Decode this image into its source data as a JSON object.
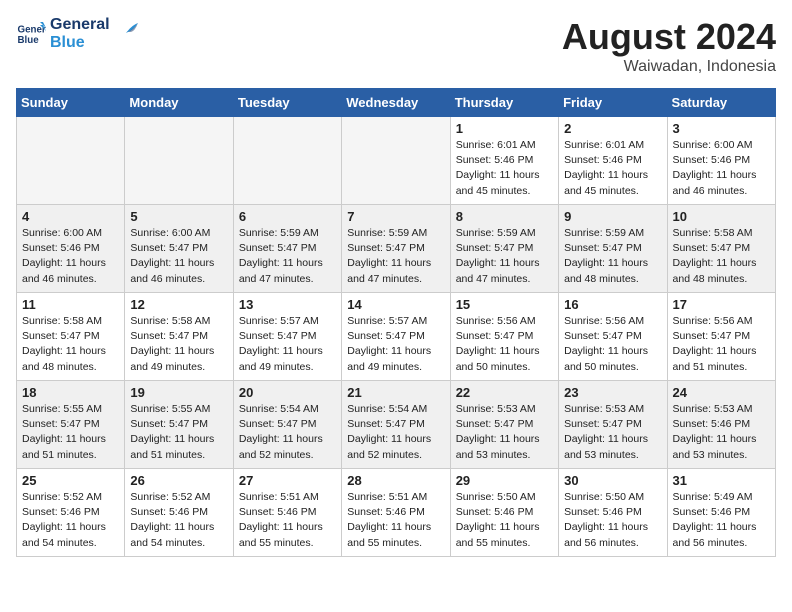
{
  "header": {
    "logo_line1": "General",
    "logo_line2": "Blue",
    "month_year": "August 2024",
    "location": "Waiwadan, Indonesia"
  },
  "weekdays": [
    "Sunday",
    "Monday",
    "Tuesday",
    "Wednesday",
    "Thursday",
    "Friday",
    "Saturday"
  ],
  "weeks": [
    [
      {
        "num": "",
        "info": "",
        "empty": true
      },
      {
        "num": "",
        "info": "",
        "empty": true
      },
      {
        "num": "",
        "info": "",
        "empty": true
      },
      {
        "num": "",
        "info": "",
        "empty": true
      },
      {
        "num": "1",
        "info": "Sunrise: 6:01 AM\nSunset: 5:46 PM\nDaylight: 11 hours\nand 45 minutes."
      },
      {
        "num": "2",
        "info": "Sunrise: 6:01 AM\nSunset: 5:46 PM\nDaylight: 11 hours\nand 45 minutes."
      },
      {
        "num": "3",
        "info": "Sunrise: 6:00 AM\nSunset: 5:46 PM\nDaylight: 11 hours\nand 46 minutes."
      }
    ],
    [
      {
        "num": "4",
        "info": "Sunrise: 6:00 AM\nSunset: 5:46 PM\nDaylight: 11 hours\nand 46 minutes."
      },
      {
        "num": "5",
        "info": "Sunrise: 6:00 AM\nSunset: 5:47 PM\nDaylight: 11 hours\nand 46 minutes."
      },
      {
        "num": "6",
        "info": "Sunrise: 5:59 AM\nSunset: 5:47 PM\nDaylight: 11 hours\nand 47 minutes."
      },
      {
        "num": "7",
        "info": "Sunrise: 5:59 AM\nSunset: 5:47 PM\nDaylight: 11 hours\nand 47 minutes."
      },
      {
        "num": "8",
        "info": "Sunrise: 5:59 AM\nSunset: 5:47 PM\nDaylight: 11 hours\nand 47 minutes."
      },
      {
        "num": "9",
        "info": "Sunrise: 5:59 AM\nSunset: 5:47 PM\nDaylight: 11 hours\nand 48 minutes."
      },
      {
        "num": "10",
        "info": "Sunrise: 5:58 AM\nSunset: 5:47 PM\nDaylight: 11 hours\nand 48 minutes."
      }
    ],
    [
      {
        "num": "11",
        "info": "Sunrise: 5:58 AM\nSunset: 5:47 PM\nDaylight: 11 hours\nand 48 minutes."
      },
      {
        "num": "12",
        "info": "Sunrise: 5:58 AM\nSunset: 5:47 PM\nDaylight: 11 hours\nand 49 minutes."
      },
      {
        "num": "13",
        "info": "Sunrise: 5:57 AM\nSunset: 5:47 PM\nDaylight: 11 hours\nand 49 minutes."
      },
      {
        "num": "14",
        "info": "Sunrise: 5:57 AM\nSunset: 5:47 PM\nDaylight: 11 hours\nand 49 minutes."
      },
      {
        "num": "15",
        "info": "Sunrise: 5:56 AM\nSunset: 5:47 PM\nDaylight: 11 hours\nand 50 minutes."
      },
      {
        "num": "16",
        "info": "Sunrise: 5:56 AM\nSunset: 5:47 PM\nDaylight: 11 hours\nand 50 minutes."
      },
      {
        "num": "17",
        "info": "Sunrise: 5:56 AM\nSunset: 5:47 PM\nDaylight: 11 hours\nand 51 minutes."
      }
    ],
    [
      {
        "num": "18",
        "info": "Sunrise: 5:55 AM\nSunset: 5:47 PM\nDaylight: 11 hours\nand 51 minutes."
      },
      {
        "num": "19",
        "info": "Sunrise: 5:55 AM\nSunset: 5:47 PM\nDaylight: 11 hours\nand 51 minutes."
      },
      {
        "num": "20",
        "info": "Sunrise: 5:54 AM\nSunset: 5:47 PM\nDaylight: 11 hours\nand 52 minutes."
      },
      {
        "num": "21",
        "info": "Sunrise: 5:54 AM\nSunset: 5:47 PM\nDaylight: 11 hours\nand 52 minutes."
      },
      {
        "num": "22",
        "info": "Sunrise: 5:53 AM\nSunset: 5:47 PM\nDaylight: 11 hours\nand 53 minutes."
      },
      {
        "num": "23",
        "info": "Sunrise: 5:53 AM\nSunset: 5:47 PM\nDaylight: 11 hours\nand 53 minutes."
      },
      {
        "num": "24",
        "info": "Sunrise: 5:53 AM\nSunset: 5:46 PM\nDaylight: 11 hours\nand 53 minutes."
      }
    ],
    [
      {
        "num": "25",
        "info": "Sunrise: 5:52 AM\nSunset: 5:46 PM\nDaylight: 11 hours\nand 54 minutes."
      },
      {
        "num": "26",
        "info": "Sunrise: 5:52 AM\nSunset: 5:46 PM\nDaylight: 11 hours\nand 54 minutes."
      },
      {
        "num": "27",
        "info": "Sunrise: 5:51 AM\nSunset: 5:46 PM\nDaylight: 11 hours\nand 55 minutes."
      },
      {
        "num": "28",
        "info": "Sunrise: 5:51 AM\nSunset: 5:46 PM\nDaylight: 11 hours\nand 55 minutes."
      },
      {
        "num": "29",
        "info": "Sunrise: 5:50 AM\nSunset: 5:46 PM\nDaylight: 11 hours\nand 55 minutes."
      },
      {
        "num": "30",
        "info": "Sunrise: 5:50 AM\nSunset: 5:46 PM\nDaylight: 11 hours\nand 56 minutes."
      },
      {
        "num": "31",
        "info": "Sunrise: 5:49 AM\nSunset: 5:46 PM\nDaylight: 11 hours\nand 56 minutes."
      }
    ]
  ]
}
